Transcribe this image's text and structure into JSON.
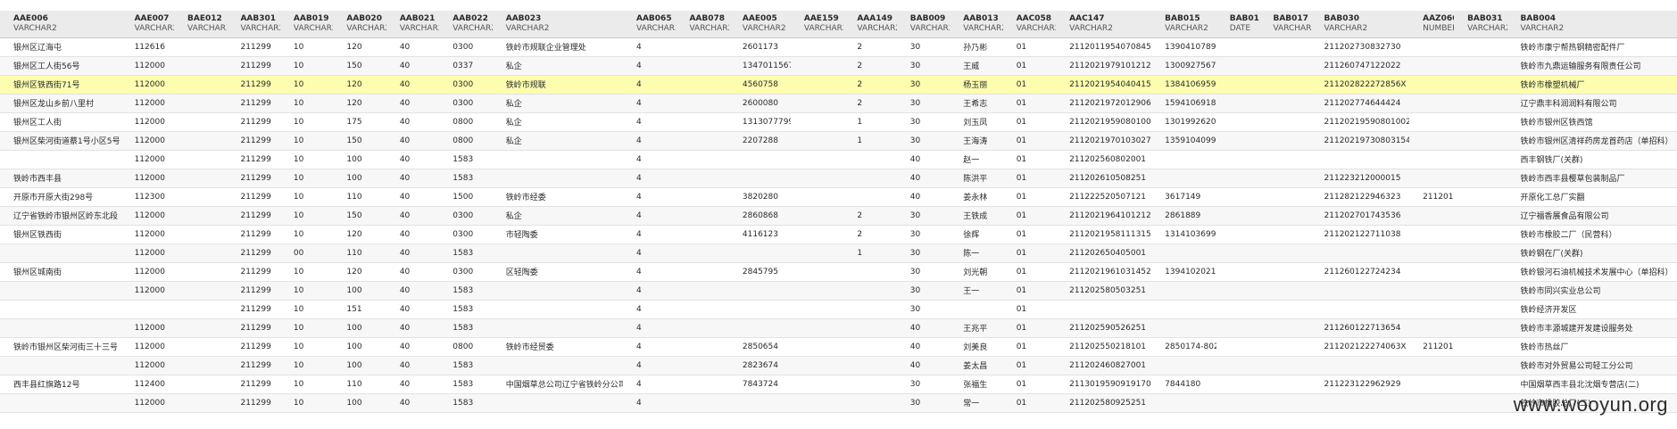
{
  "columns": [
    {
      "name": "AAE006",
      "type": "VARCHAR2"
    },
    {
      "name": "AAE007",
      "type": "VARCHAR2"
    },
    {
      "name": "BAE012",
      "type": "VARCHAR2"
    },
    {
      "name": "AAB301",
      "type": "VARCHAR2"
    },
    {
      "name": "AAB019",
      "type": "VARCHAR2"
    },
    {
      "name": "AAB020",
      "type": "VARCHAR2"
    },
    {
      "name": "AAB021",
      "type": "VARCHAR2"
    },
    {
      "name": "AAB022",
      "type": "VARCHAR2"
    },
    {
      "name": "AAB023",
      "type": "VARCHAR2"
    },
    {
      "name": "AAB065",
      "type": "VARCHAR2"
    },
    {
      "name": "AAB078",
      "type": "VARCHAR2"
    },
    {
      "name": "AAE005",
      "type": "VARCHAR2"
    },
    {
      "name": "AAE159",
      "type": "VARCHAR2"
    },
    {
      "name": "AAA149",
      "type": "VARCHAR2"
    },
    {
      "name": "BAB009",
      "type": "VARCHAR2"
    },
    {
      "name": "AAB013",
      "type": "VARCHAR2"
    },
    {
      "name": "AAC058",
      "type": "VARCHAR2"
    },
    {
      "name": "AAC147",
      "type": "VARCHAR2"
    },
    {
      "name": "BAB015",
      "type": "VARCHAR2"
    },
    {
      "name": "BAB016",
      "type": "DATE"
    },
    {
      "name": "BAB017",
      "type": "VARCHAR2"
    },
    {
      "name": "BAB030",
      "type": "VARCHAR2"
    },
    {
      "name": "AAZ066",
      "type": "NUMBER"
    },
    {
      "name": "BAB031",
      "type": "VARCHAR2"
    },
    {
      "name": "BAB004",
      "type": "VARCHAR2"
    }
  ],
  "selected_row": 2,
  "rows": [
    [
      "银州区辽海屯",
      "112616",
      "",
      "211299",
      "10",
      "120",
      "40",
      "0300",
      "铁岭市规联企业管理处",
      "4",
      "",
      "2601173",
      "",
      "2",
      "30",
      "孙乃彬",
      "01",
      "211201195407084514",
      "13904107893",
      "",
      "",
      "211202730832730",
      "",
      "",
      "铁岭市康宁帮热钢精密配件厂"
    ],
    [
      "银州区工人街56号",
      "112000",
      "",
      "211299",
      "10",
      "150",
      "40",
      "0337",
      "私企",
      "4",
      "",
      "13470115678",
      "",
      "2",
      "30",
      "王威",
      "01",
      "211202197910121297",
      "13009275678",
      "",
      "",
      "211260747122022",
      "",
      "",
      "铁岭市九鼎运输服务有限责任公司"
    ],
    [
      "银州区铁西街71号",
      "112000",
      "",
      "211299",
      "10",
      "120",
      "40",
      "0300",
      "铁岭市规联",
      "4",
      "",
      "4560758",
      "",
      "2",
      "30",
      "杨玉丽",
      "01",
      "211202195404041543",
      "13841069595",
      "",
      "",
      "21120282227285​6X",
      "",
      "",
      "铁岭市橡塑机械厂"
    ],
    [
      "银州区龙山乡前八里村",
      "112000",
      "",
      "211299",
      "10",
      "120",
      "40",
      "0300",
      "私企",
      "4",
      "",
      "2600080",
      "",
      "2",
      "30",
      "王希志",
      "01",
      "211202197201290616",
      "15941069188",
      "",
      "",
      "211202774644424",
      "",
      "",
      "辽宁鼎丰科润润料有限公司"
    ],
    [
      "银州区工人街",
      "112000",
      "",
      "211299",
      "10",
      "175",
      "40",
      "0800",
      "私企",
      "4",
      "",
      "13130777994",
      "",
      "1",
      "30",
      "刘玉凤",
      "01",
      "21120219590801002X",
      "13019926203",
      "",
      "",
      "21120219590801002XA",
      "",
      "",
      "铁岭市银州区铁西馆"
    ],
    [
      "银州区柴河街道蔡1号小区5号",
      "112000",
      "",
      "211299",
      "10",
      "150",
      "40",
      "0800",
      "私企",
      "4",
      "",
      "2207288",
      "",
      "1",
      "30",
      "王海涛",
      "01",
      "211202197010302770",
      "13591040999",
      "",
      "",
      "211202197308031547",
      "",
      "",
      "铁岭市银州区清祥药房龙首药店（单招科）"
    ],
    [
      "",
      "112000",
      "",
      "211299",
      "10",
      "100",
      "40",
      "1583",
      "",
      "4",
      "",
      "",
      "",
      "",
      "40",
      "赵一",
      "01",
      "211202560802001",
      "",
      "",
      "",
      "",
      "",
      "",
      "西丰钢铁厂(关群)"
    ],
    [
      "铁岭市西丰县",
      "112000",
      "",
      "211299",
      "10",
      "100",
      "40",
      "1583",
      "",
      "4",
      "",
      "",
      "",
      "",
      "40",
      "陈洪平",
      "01",
      "211202610508251",
      "",
      "",
      "",
      "211223212000015",
      "",
      "",
      "铁岭市西丰县樱草包装制品厂"
    ],
    [
      "开原市开原大街298号",
      "112300",
      "",
      "211299",
      "10",
      "110",
      "40",
      "1500",
      "铁岭市经委",
      "4",
      "",
      "3820280",
      "",
      "",
      "40",
      "姜永林",
      "01",
      "211222520507121",
      "3617149",
      "",
      "",
      "211282122946323",
      "211201",
      "",
      "开原化工总厂实翻"
    ],
    [
      "辽宁省铁岭市银州区岭东北段",
      "112000",
      "",
      "211299",
      "10",
      "150",
      "40",
      "0300",
      "私企",
      "4",
      "",
      "2860868",
      "",
      "2",
      "30",
      "王铁成",
      "01",
      "211202196410121​23",
      "2861889",
      "",
      "",
      "211202701743536",
      "",
      "",
      "辽宁福香展食品有限公司"
    ],
    [
      "银州区铁西街",
      "112000",
      "",
      "211299",
      "10",
      "120",
      "40",
      "0300",
      "市轻陶委",
      "4",
      "",
      "4116123",
      "",
      "2",
      "30",
      "徐辉",
      "01",
      "211202195811131546",
      "13141036995",
      "",
      "",
      "211202122711038",
      "",
      "",
      "铁岭市橡胶二厂（民营科）"
    ],
    [
      "",
      "112000",
      "",
      "211299",
      "00",
      "110",
      "40",
      "1583",
      "",
      "4",
      "",
      "",
      "",
      "1",
      "30",
      "陈一",
      "01",
      "211202650405001",
      "",
      "",
      "",
      "",
      "",
      "",
      "铁岭钢在厂(关群)"
    ],
    [
      "银州区城南街",
      "112000",
      "",
      "211299",
      "10",
      "120",
      "40",
      "0300",
      "区轻陶委",
      "4",
      "",
      "2845795",
      "",
      "",
      "30",
      "刘光朝",
      "01",
      "211202196103145212",
      "13941020211",
      "",
      "",
      "211260122724234",
      "",
      "",
      "铁岭银河石油机械技术发展中心（单招科）"
    ],
    [
      "",
      "112000",
      "",
      "211299",
      "10",
      "100",
      "40",
      "1583",
      "",
      "4",
      "",
      "",
      "",
      "",
      "30",
      "王一",
      "01",
      "211202580503251",
      "",
      "",
      "",
      "",
      "",
      "",
      "铁岭市同兴实业总公司"
    ],
    [
      "",
      "",
      "",
      "211299",
      "10",
      "151",
      "40",
      "1583",
      "",
      "4",
      "",
      "",
      "",
      "",
      "30",
      "",
      "01",
      "",
      "",
      "",
      "",
      "",
      "",
      "",
      "铁岭经济开发区"
    ],
    [
      "",
      "112000",
      "",
      "211299",
      "10",
      "100",
      "40",
      "1583",
      "",
      "4",
      "",
      "",
      "",
      "",
      "40",
      "王兆平",
      "01",
      "211202590526251",
      "",
      "",
      "",
      "211260122713654",
      "",
      "",
      "铁岭市丰源城建开发建设服务处"
    ],
    [
      "铁岭市银州区柴河街三十三号",
      "112000",
      "",
      "211299",
      "10",
      "100",
      "40",
      "0800",
      "铁岭市经贸委",
      "4",
      "",
      "2850654",
      "",
      "",
      "40",
      "刘美良",
      "01",
      "211202550218101",
      "2850174-8029",
      "",
      "",
      "21120212227406​3X",
      "211201",
      "",
      "铁岭市热丝厂"
    ],
    [
      "",
      "112000",
      "",
      "211299",
      "10",
      "100",
      "40",
      "1583",
      "",
      "4",
      "",
      "2823674",
      "",
      "",
      "40",
      "姜太昌",
      "01",
      "211202460827001",
      "",
      "",
      "",
      "",
      "",
      "",
      "铁岭市对外贸易公司轻工分公司"
    ],
    [
      "西丰县红旗路12号",
      "112400",
      "",
      "211299",
      "10",
      "110",
      "40",
      "1583",
      "中国烟草总公司辽宁省铁岭分公司",
      "4",
      "",
      "7843724",
      "",
      "",
      "30",
      "张福生",
      "01",
      "211301959091917081",
      "7844180",
      "",
      "",
      "211223122962929",
      "",
      "",
      "中国烟草西丰县北沈烟专营店(二)"
    ],
    [
      "",
      "112000",
      "",
      "211299",
      "10",
      "100",
      "40",
      "1583",
      "",
      "4",
      "",
      "",
      "",
      "",
      "30",
      "常一",
      "01",
      "211202580925251",
      "",
      "",
      "",
      "",
      "",
      "",
      "铁岭市橡胶总厂(二)"
    ]
  ],
  "watermark": "www.wooyun.org"
}
